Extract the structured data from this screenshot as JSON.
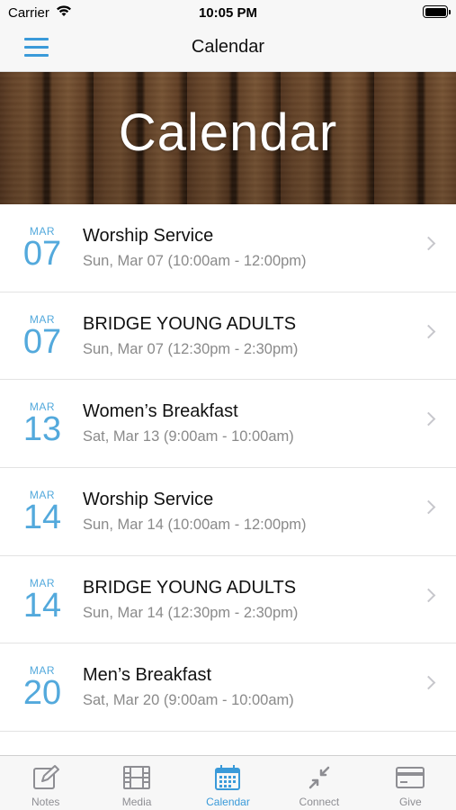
{
  "status_bar": {
    "carrier": "Carrier",
    "time": "10:05 PM"
  },
  "nav": {
    "title": "Calendar",
    "menu_icon": "hamburger-menu-icon"
  },
  "hero": {
    "title": "Calendar"
  },
  "events": [
    {
      "month": "MAR",
      "day": "07",
      "title": "Worship Service",
      "time": "Sun, Mar 07 (10:00am - 12:00pm)"
    },
    {
      "month": "MAR",
      "day": "07",
      "title": "BRIDGE YOUNG ADULTS",
      "time": "Sun, Mar 07 (12:30pm - 2:30pm)"
    },
    {
      "month": "MAR",
      "day": "13",
      "title": "Women’s Breakfast",
      "time": "Sat, Mar 13 (9:00am - 10:00am)"
    },
    {
      "month": "MAR",
      "day": "14",
      "title": "Worship Service",
      "time": "Sun, Mar 14 (10:00am - 12:00pm)"
    },
    {
      "month": "MAR",
      "day": "14",
      "title": "BRIDGE YOUNG ADULTS",
      "time": "Sun, Mar 14 (12:30pm - 2:30pm)"
    },
    {
      "month": "MAR",
      "day": "20",
      "title": "Men’s Breakfast",
      "time": "Sat, Mar 20 (9:00am - 10:00am)"
    }
  ],
  "tabs": [
    {
      "label": "Notes",
      "icon": "notes-icon",
      "active": false
    },
    {
      "label": "Media",
      "icon": "film-icon",
      "active": false
    },
    {
      "label": "Calendar",
      "icon": "calendar-icon",
      "active": true
    },
    {
      "label": "Connect",
      "icon": "connect-icon",
      "active": false
    },
    {
      "label": "Give",
      "icon": "credit-card-icon",
      "active": false
    }
  ],
  "colors": {
    "accent": "#3a9ad9",
    "date": "#53a9dc",
    "subtitle": "#8a8a8a",
    "tab_inactive": "#8e8e93"
  }
}
